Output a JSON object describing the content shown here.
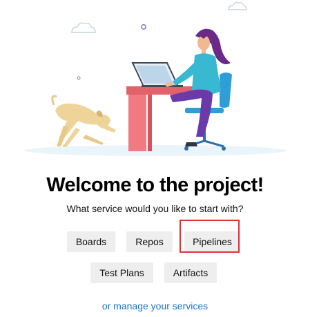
{
  "welcome": {
    "title": "Welcome to the project!",
    "subtitle": "What service would you like to start with?"
  },
  "services": {
    "boards": "Boards",
    "repos": "Repos",
    "pipelines": "Pipelines",
    "test_plans": "Test Plans",
    "artifacts": "Artifacts"
  },
  "manage_link": "or manage your services",
  "colors": {
    "link": "#1b74c9",
    "highlight_border": "#d8343a",
    "button_bg": "#eeeeee"
  }
}
